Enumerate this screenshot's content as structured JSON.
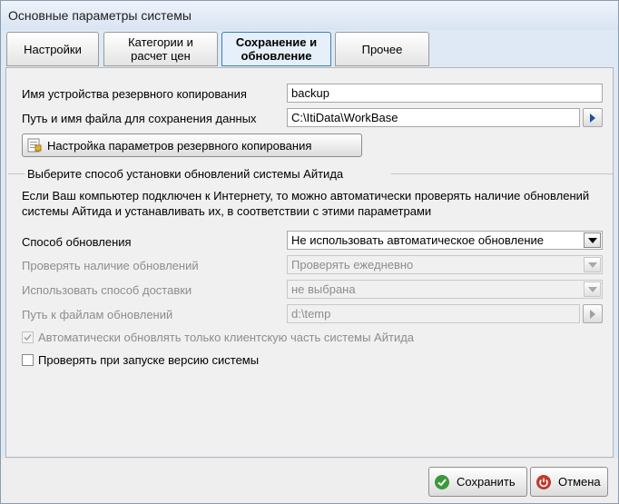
{
  "window": {
    "title": "Основные параметры системы"
  },
  "tabs": [
    {
      "label": "Настройки"
    },
    {
      "label": "Категории и расчет цен"
    },
    {
      "label": "Сохранение и обновление"
    },
    {
      "label": "Прочее"
    }
  ],
  "backup": {
    "device_label": "Имя устройства резервного копирования",
    "device_value": "backup",
    "path_label": "Путь и имя файла для сохранения данных",
    "path_value": "C:\\ItiData\\WorkBase",
    "settings_button": "Настройка параметров резервного копирования"
  },
  "updates": {
    "group_title": "Выберите способ установки обновлений системы Айтида",
    "description": "Если Ваш компьютер подключен к Интернету, то можно автоматически проверять наличие обновлений системы Айтида и устанавливать их, в соответствии с этими параметрами",
    "method_label": "Способ обновления",
    "method_value": "Не использовать автоматическое обновление",
    "check_label": "Проверять наличие обновлений",
    "check_value": "Проверять ежедневно",
    "delivery_label": "Использовать способ доставки",
    "delivery_value": "не выбрана",
    "path_label": "Путь к файлам обновлений",
    "path_value": "d:\\temp",
    "auto_client_label": "Автоматически обновлять только клиентскую часть системы Айтида",
    "auto_client_checked": true,
    "check_on_start_label": "Проверять при запуске  версию системы",
    "check_on_start_checked": false
  },
  "footer": {
    "save_label": "Сохранить",
    "cancel_label": "Отмена"
  },
  "colors": {
    "accent": "#3c7fb1",
    "save_icon": "#3a9a3a",
    "cancel_icon": "#c0392b"
  }
}
